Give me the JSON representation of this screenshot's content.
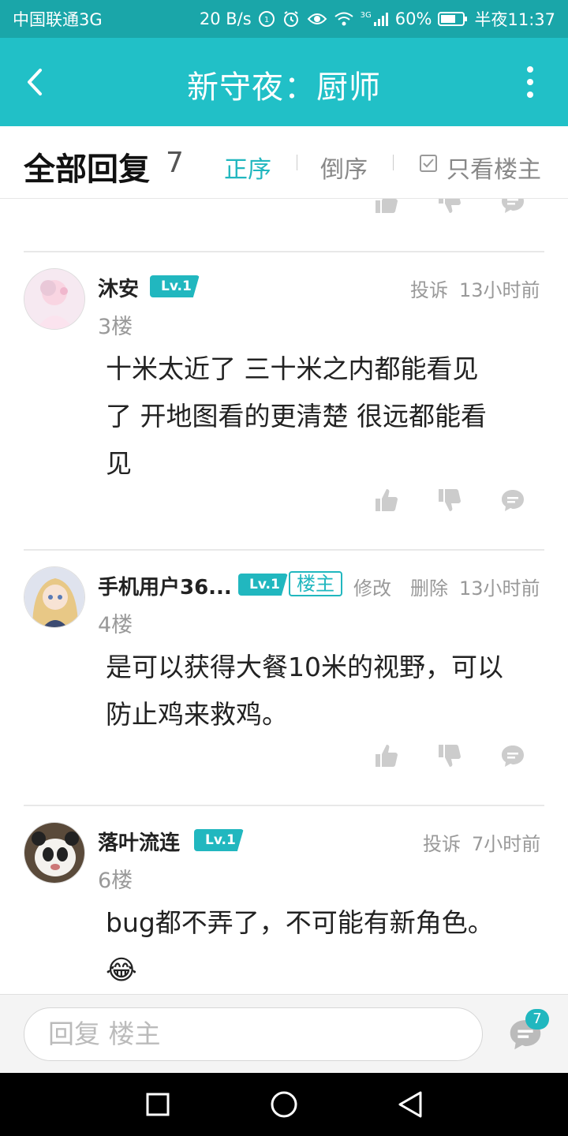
{
  "status_bar": {
    "carrier": "中国联通3G",
    "speed": "20 B/s",
    "network": "3G",
    "battery": "60%",
    "time": "半夜11:37"
  },
  "titlebar": {
    "title": "新守夜：厨师"
  },
  "sort": {
    "heading": "全部回复",
    "count": "7",
    "asc": "正序",
    "desc": "倒序",
    "only_op": "只看楼主"
  },
  "posts": [
    {
      "username": "沐安",
      "level": "Lv.1",
      "report": "投诉",
      "time": "13小时前",
      "floor": "3楼",
      "lines": [
        "十米太近了 三十米之内都能看见",
        "了 开地图看的更清楚 很远都能看",
        "见"
      ]
    },
    {
      "username": "手机用户36...",
      "level": "Lv.1",
      "owner_badge": "楼主",
      "edit": "修改",
      "delete": "删除",
      "time": "13小时前",
      "floor": "4楼",
      "lines": [
        "是可以获得大餐10米的视野，可以",
        "防止鸡来救鸡。"
      ]
    },
    {
      "username": "落叶流连",
      "level": "Lv.1",
      "report": "投诉",
      "time": "7小时前",
      "floor": "6楼",
      "lines": [
        "bug都不弄了，不可能有新角色。"
      ],
      "emoji": "😂"
    }
  ],
  "reply": {
    "placeholder": "回复  楼主",
    "comment_count": "7"
  },
  "colors": {
    "status_bg": "#1aa6a9",
    "header_bg": "#21c0c7",
    "accent": "#21b7bf"
  }
}
